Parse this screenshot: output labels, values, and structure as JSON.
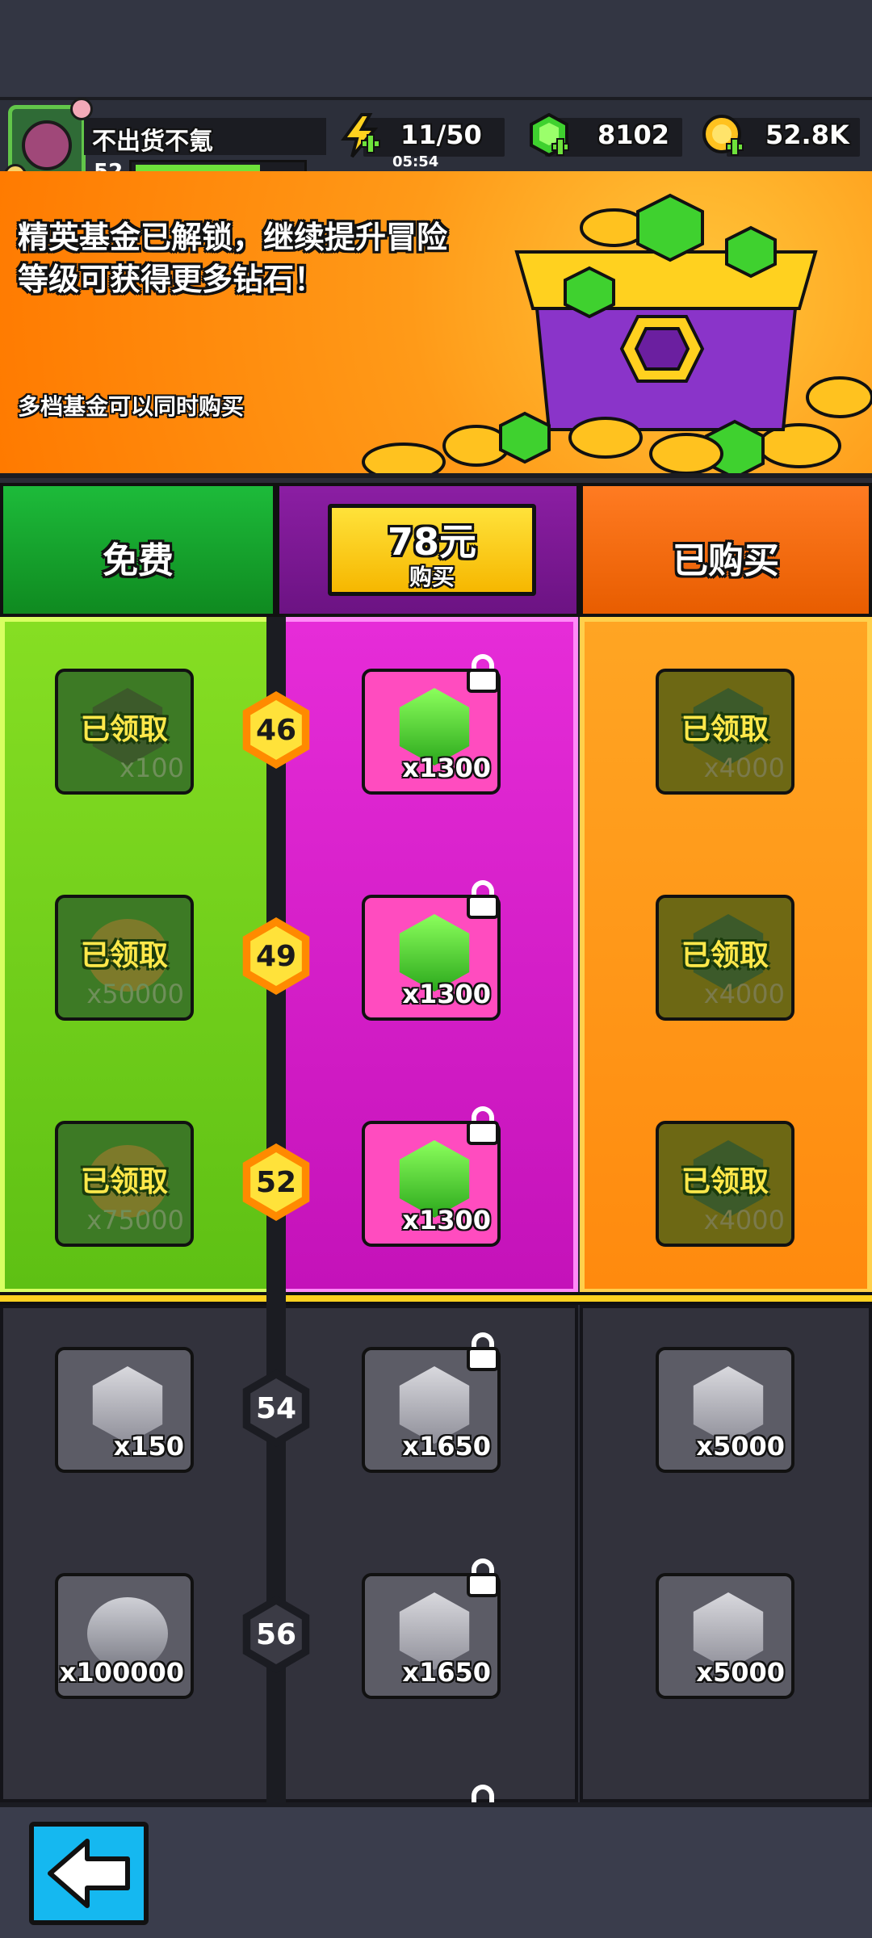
{
  "player": {
    "name": "不出货不氪",
    "level": "52",
    "xp_progress": 0.7
  },
  "resources": {
    "energy": {
      "value": "11/50",
      "timer": "05:54",
      "icon": "lightning-icon"
    },
    "gems": {
      "value": "8102",
      "icon": "gem-icon"
    },
    "coins": {
      "value": "52.8K",
      "icon": "coin-icon"
    }
  },
  "banner": {
    "line1": "精英基金已解锁，继续提升冒险",
    "line2": "等级可获得更多钻石！",
    "note": "多档基金可以同时购买",
    "image": "treasure-chest-gems-coins"
  },
  "columns": {
    "free_label": "免费",
    "price_label": "78元",
    "buy_label": "购买",
    "bought_label": "已购买"
  },
  "claimed_label": "已领取",
  "levels": [
    "46",
    "49",
    "52",
    "54",
    "56"
  ],
  "rows": [
    {
      "free": {
        "amount": "x100",
        "type": "gem",
        "claimed": true
      },
      "paid": {
        "amount": "x1300",
        "locked": true
      },
      "bought": {
        "amount": "x4000",
        "claimed": true
      }
    },
    {
      "free": {
        "amount": "x50000",
        "type": "coin",
        "claimed": true
      },
      "paid": {
        "amount": "x1300",
        "locked": true
      },
      "bought": {
        "amount": "x4000",
        "claimed": true
      }
    },
    {
      "free": {
        "amount": "x75000",
        "type": "coin",
        "claimed": true
      },
      "paid": {
        "amount": "x1300",
        "locked": true
      },
      "bought": {
        "amount": "x4000",
        "claimed": true
      }
    },
    {
      "free": {
        "amount": "x150",
        "type": "gem"
      },
      "paid": {
        "amount": "x1650",
        "locked": true
      },
      "bought": {
        "amount": "x5000"
      }
    },
    {
      "free": {
        "amount": "x100000",
        "type": "coin"
      },
      "paid": {
        "amount": "x1650",
        "locked": true
      },
      "bought": {
        "amount": "x5000"
      }
    }
  ],
  "colors": {
    "free": "#1dbb3a",
    "paid": "#8b1ea3",
    "bought": "#ff7b22",
    "accent": "#ffd11f"
  },
  "nav": {
    "back_icon": "back-arrow-icon"
  }
}
